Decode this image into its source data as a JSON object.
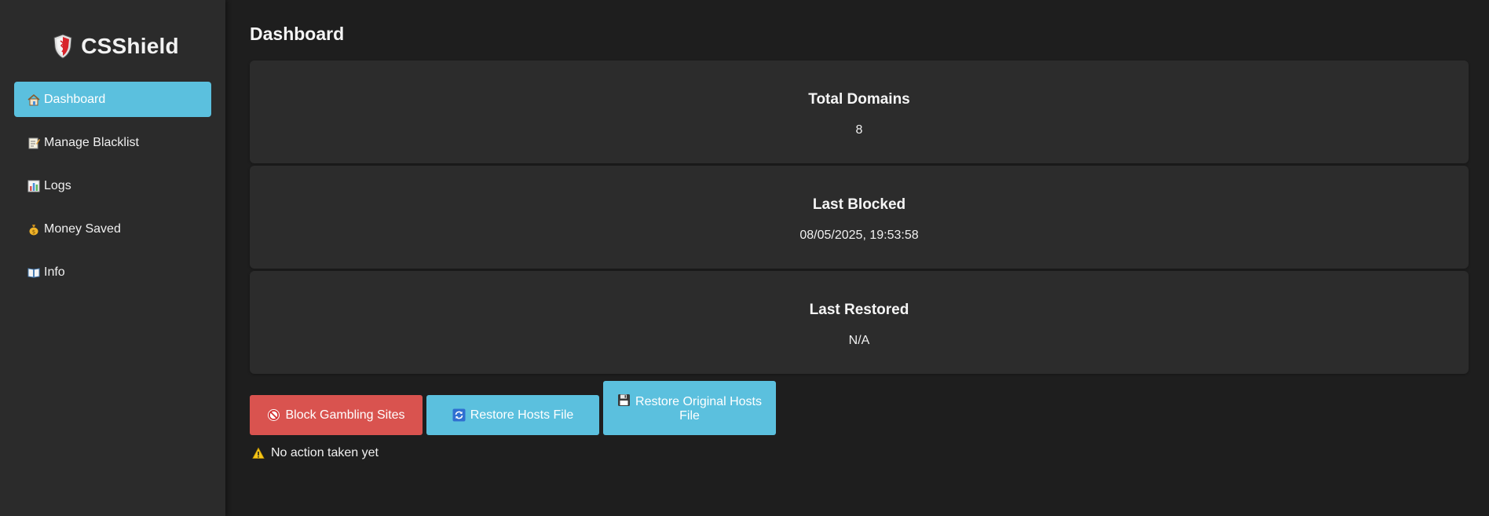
{
  "app": {
    "name": "CSShield",
    "brand_icon": "shield-icon",
    "accent_color": "#5bc0de",
    "danger_color": "#d9534f"
  },
  "sidebar": {
    "items": [
      {
        "label": "Dashboard",
        "icon": "home-icon",
        "active": true
      },
      {
        "label": "Manage Blacklist",
        "icon": "memo-icon",
        "active": false
      },
      {
        "label": "Logs",
        "icon": "bar-chart-icon",
        "active": false
      },
      {
        "label": "Money Saved",
        "icon": "money-bag-icon",
        "active": false
      },
      {
        "label": "Info",
        "icon": "book-icon",
        "active": false
      }
    ]
  },
  "main": {
    "title": "Dashboard",
    "cards": [
      {
        "title": "Total Domains",
        "value": "8"
      },
      {
        "title": "Last Blocked",
        "value": "08/05/2025, 19:53:58"
      },
      {
        "title": "Last Restored",
        "value": "N/A"
      }
    ],
    "buttons": {
      "block": {
        "label": "Block Gambling Sites",
        "icon": "prohibited-icon"
      },
      "restore": {
        "label": "Restore Hosts File",
        "icon": "refresh-icon"
      },
      "restore_original": {
        "label": "Restore Original Hosts File",
        "icon": "floppy-disk-icon"
      }
    },
    "status": {
      "text": "No action taken yet",
      "icon": "warning-icon"
    }
  }
}
